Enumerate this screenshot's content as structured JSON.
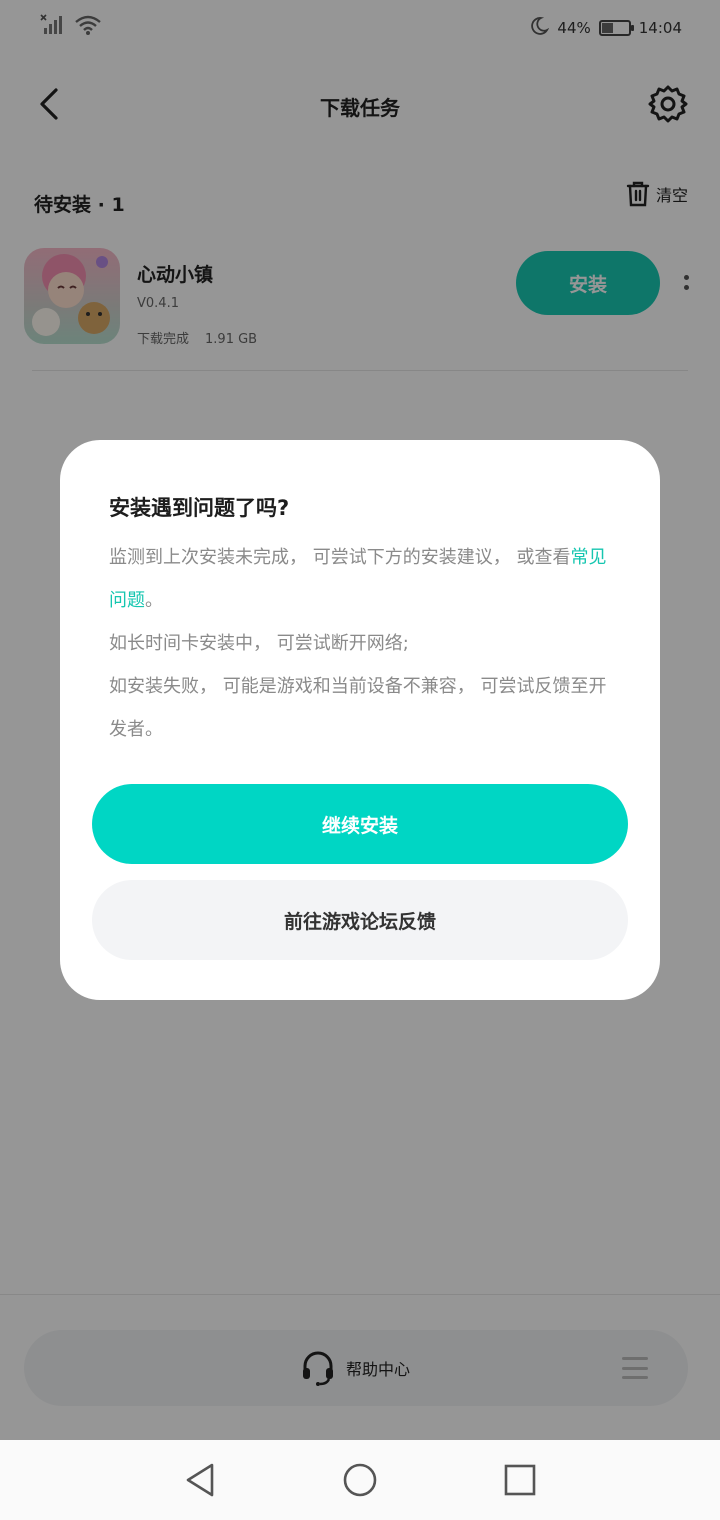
{
  "status_bar": {
    "battery_text": "44%",
    "battery_level": 0.44,
    "time": "14:04",
    "icons": [
      "signal-off-icon",
      "wifi-icon",
      "moon-icon",
      "battery-icon"
    ]
  },
  "header": {
    "title": "下载任务",
    "back_icon": "chevron-left-icon",
    "settings_icon": "gear-icon"
  },
  "section": {
    "title": "待安装 · 1",
    "clear_label": "清空"
  },
  "app": {
    "name": "心动小镇",
    "version": "V0.4.1",
    "status": "下载完成",
    "size": "1.91 GB",
    "install_label": "安装"
  },
  "dialog": {
    "title": "安装遇到问题了吗?",
    "line1_prefix": "监测到上次安装未完成， 可尝试下方的安装建议， 或查看",
    "faq_link": "常见问题",
    "line1_suffix": "。",
    "line2": "如长时间卡安装中， 可尝试断开网络;",
    "line3": "如安装失败， 可能是游戏和当前设备不兼容， 可尝试反馈至开发者。",
    "continue_label": "继续安装",
    "forum_label": "前往游戏论坛反馈"
  },
  "bottom": {
    "help_label": "帮助中心"
  },
  "colors": {
    "accent": "#00d6c4",
    "install_button": "#18c9b3",
    "overlay": "rgba(0,0,0,0.41)"
  }
}
